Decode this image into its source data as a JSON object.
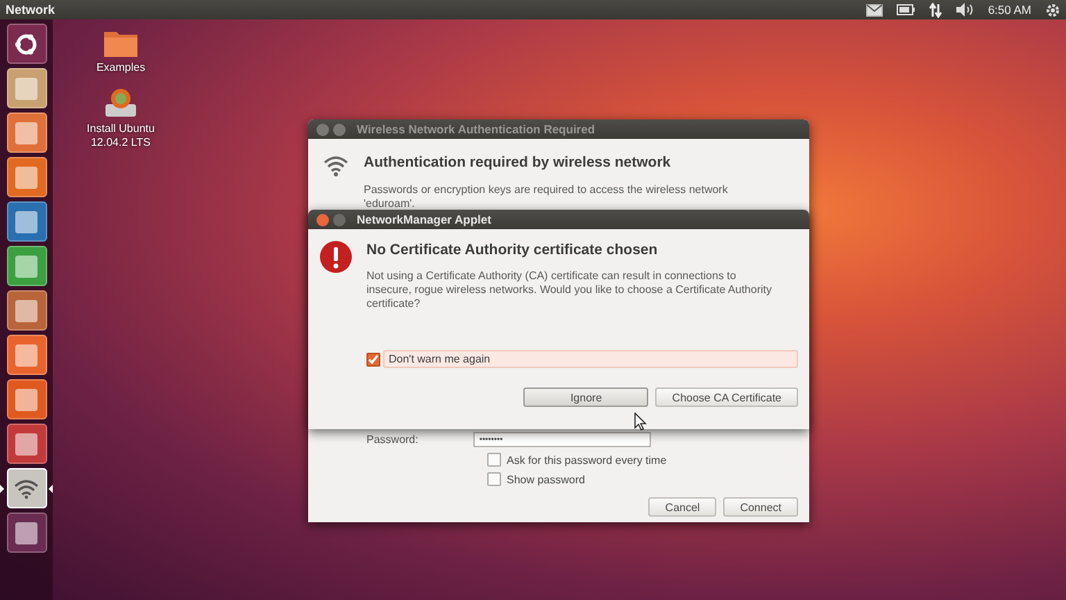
{
  "top_panel": {
    "title": "Network",
    "clock": "6:50 AM"
  },
  "launcher": {
    "items": [
      {
        "selected": false
      },
      {
        "selected": false
      },
      {
        "selected": false
      },
      {
        "selected": false
      },
      {
        "selected": false
      },
      {
        "selected": false
      },
      {
        "selected": false
      },
      {
        "selected": false
      },
      {
        "selected": false
      },
      {
        "selected": false
      },
      {
        "selected": true
      },
      {
        "selected": false
      }
    ]
  },
  "desktop_icons": [
    {
      "lines": [
        "Examples"
      ]
    },
    {
      "lines": [
        "Install Ubuntu",
        "12.04.2 LTS"
      ]
    }
  ],
  "auth_dialog": {
    "title": "Wireless Network Authentication Required",
    "heading": "Authentication required by wireless network",
    "text": "Passwords or encryption keys are required to access the wireless network 'eduroam'.",
    "password_label": "Password:",
    "password_value": "••••••••",
    "options": [
      {
        "label": "Ask for this password every time",
        "checked": false
      },
      {
        "label": "Show password",
        "checked": false
      }
    ],
    "buttons": [
      "Cancel",
      "Connect"
    ]
  },
  "alert_dialog": {
    "title": "NetworkManager Applet",
    "heading": "No Certificate Authority certificate chosen",
    "text": "Not using a Certificate Authority (CA) certificate can result in connections to insecure, rogue wireless networks.  Would you like to choose a Certificate Authority certificate?",
    "option": {
      "label": "Don't warn me again",
      "checked": true
    },
    "buttons": [
      {
        "label": "Ignore",
        "selected": true
      },
      {
        "label": "Choose CA Certificate",
        "selected": false
      }
    ]
  }
}
